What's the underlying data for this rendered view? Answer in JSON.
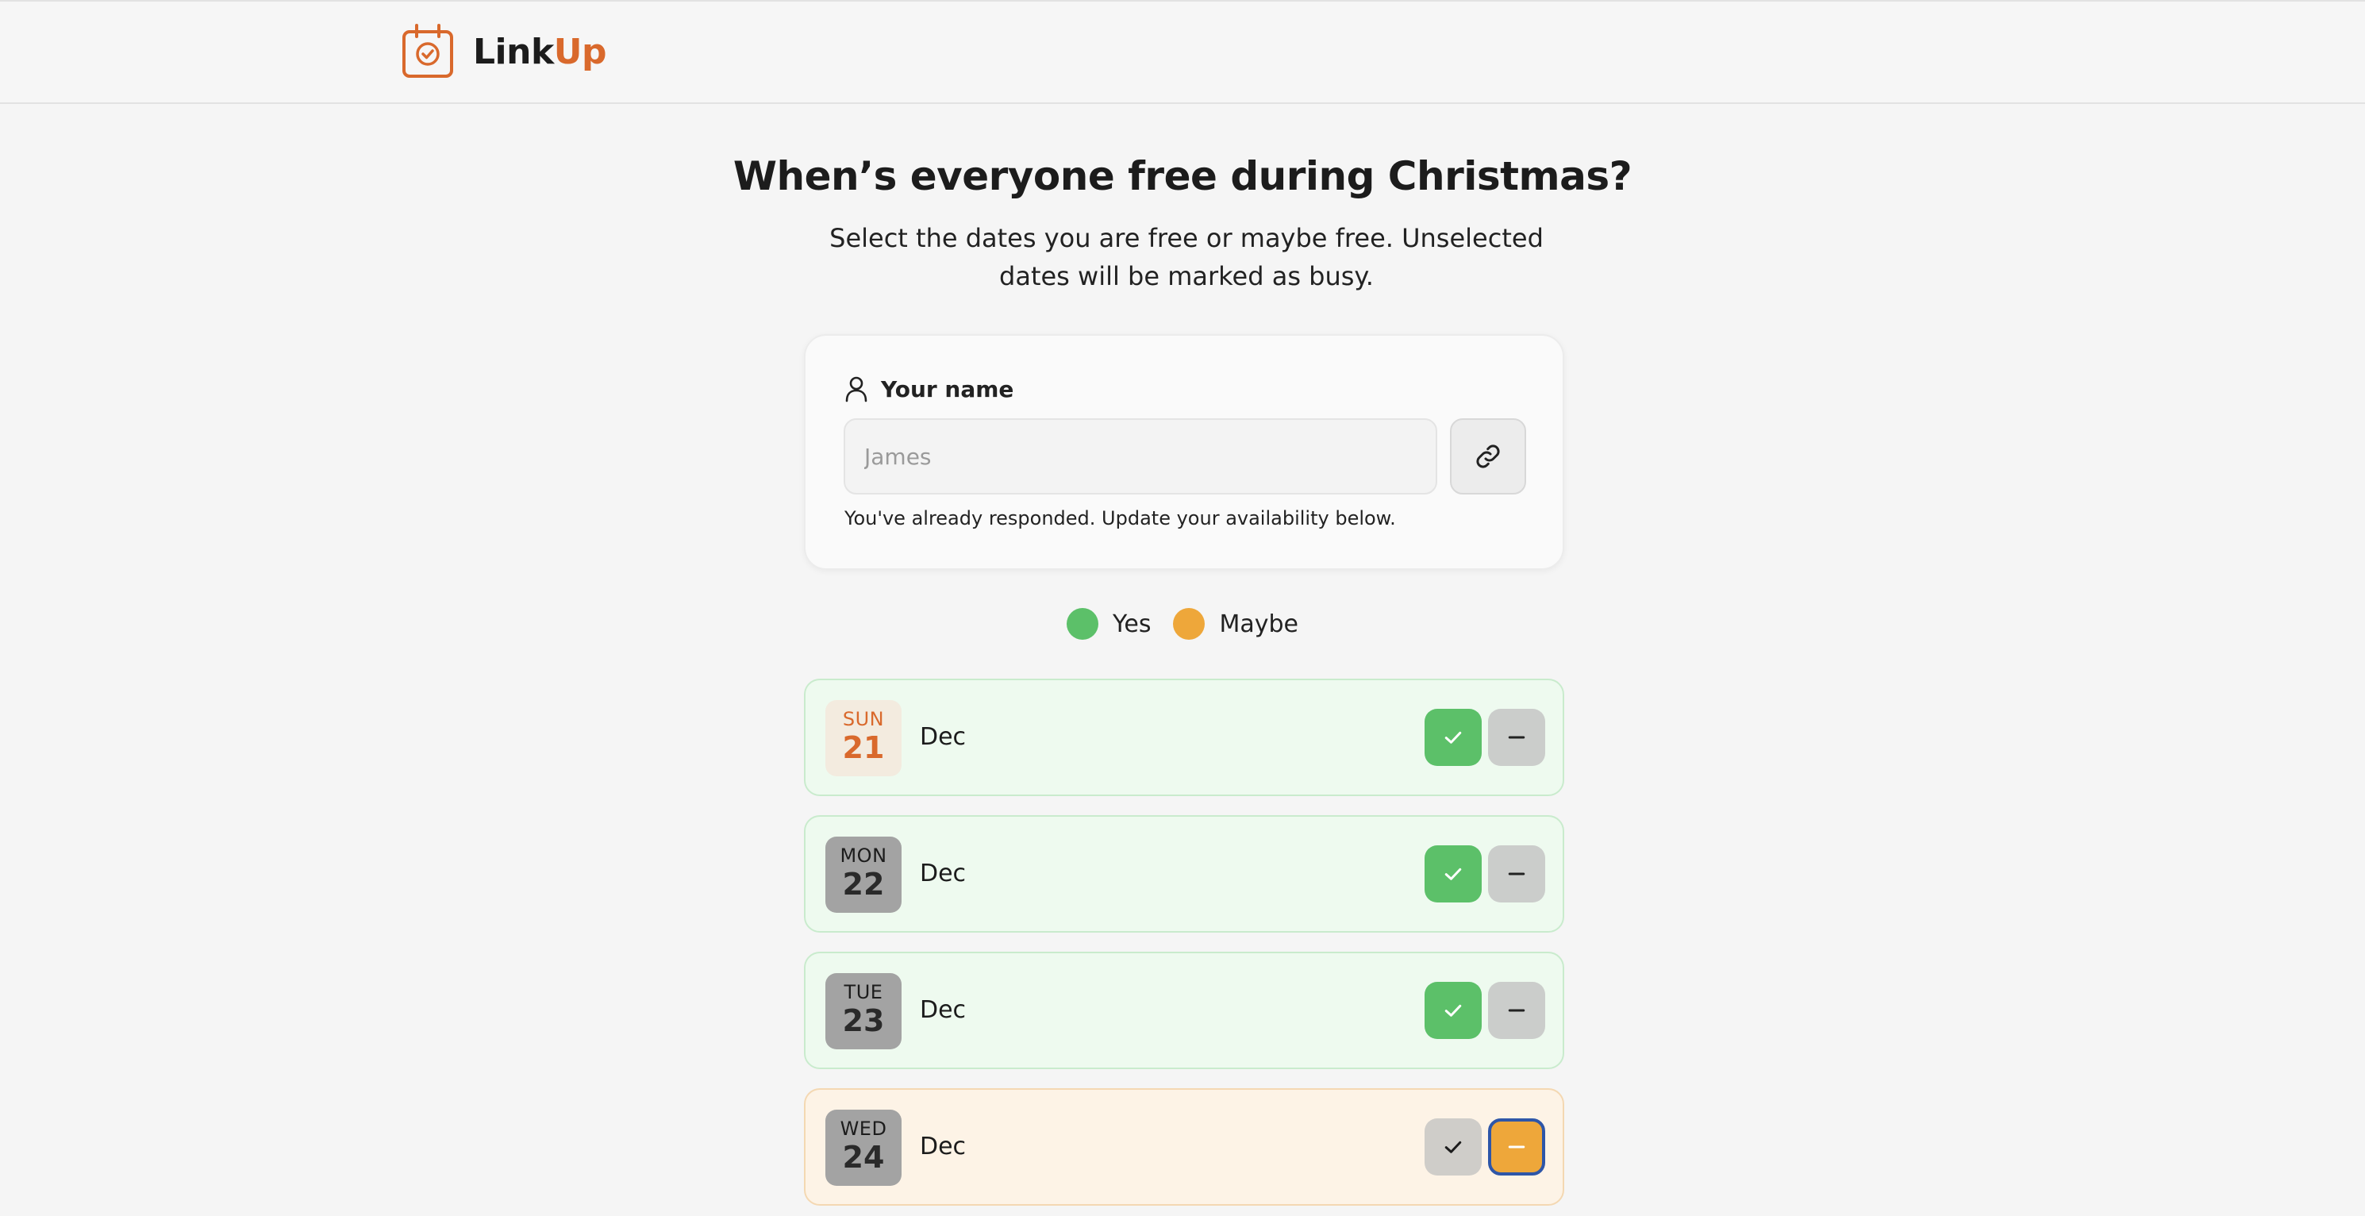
{
  "header": {
    "brand_part1": "Link",
    "brand_part2": "Up",
    "brand_color": "#d9692c"
  },
  "page": {
    "title": "When’s everyone free during Christmas?",
    "subtitle": "Select the dates you are free or maybe free. Unselected dates will be marked as busy."
  },
  "form": {
    "name_label": "Your name",
    "name_value": "",
    "name_placeholder": "James",
    "hint": "You've already responded. Update your availability below."
  },
  "legend": {
    "yes_label": "Yes",
    "yes_color": "#5cc069",
    "maybe_label": "Maybe",
    "maybe_color": "#eea73a"
  },
  "dates": [
    {
      "dow": "SUN",
      "day": "21",
      "month": "Dec",
      "status": "yes",
      "today": true
    },
    {
      "dow": "MON",
      "day": "22",
      "month": "Dec",
      "status": "yes",
      "today": false
    },
    {
      "dow": "TUE",
      "day": "23",
      "month": "Dec",
      "status": "yes",
      "today": false
    },
    {
      "dow": "WED",
      "day": "24",
      "month": "Dec",
      "status": "maybe",
      "today": false
    }
  ]
}
